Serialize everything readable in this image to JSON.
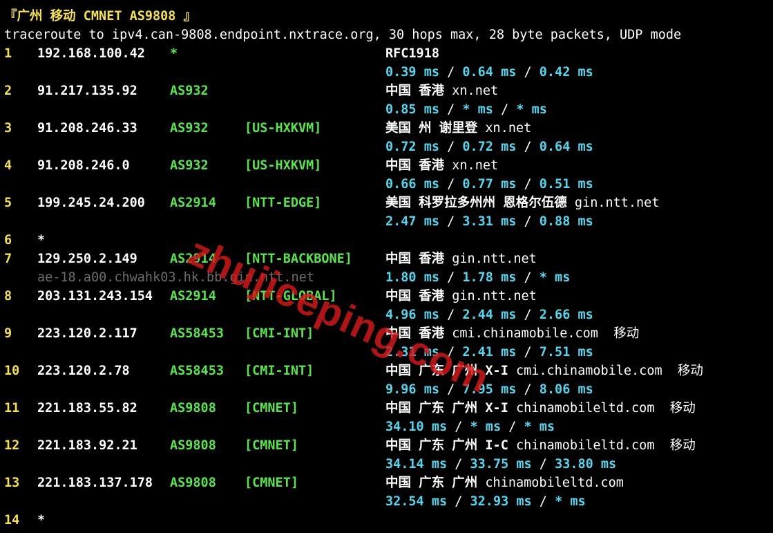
{
  "header": {
    "title": "『广州 移动 CMNET AS9808 』",
    "command": "traceroute to ipv4.can-9808.endpoint.nxtrace.org, 30 hops max, 28 byte packets, UDP mode"
  },
  "hops": [
    {
      "hop": "1",
      "ip": "192.168.100.42",
      "as": "*",
      "tag": "",
      "geo": "RFC1918",
      "org": "",
      "isp": "",
      "rtt": [
        "0.39 ms",
        "0.64 ms",
        "0.42 ms"
      ],
      "rdns": ""
    },
    {
      "hop": "2",
      "ip": "91.217.135.92",
      "as": "AS932",
      "tag": "",
      "geo": "中国 香港 ",
      "org": "xn.net",
      "isp": "",
      "rtt": [
        "0.85 ms",
        "* ms",
        "* ms"
      ],
      "rdns": ""
    },
    {
      "hop": "3",
      "ip": "91.208.246.33",
      "as": "AS932",
      "tag": "[US-HXKVM]",
      "geo": "美国 州 谢里登 ",
      "org": "xn.net",
      "isp": "",
      "rtt": [
        "0.72 ms",
        "0.72 ms",
        "0.64 ms"
      ],
      "rdns": ""
    },
    {
      "hop": "4",
      "ip": "91.208.246.0",
      "as": "AS932",
      "tag": "[US-HXKVM]",
      "geo": "中国 香港 ",
      "org": "xn.net",
      "isp": "",
      "rtt": [
        "0.66 ms",
        "0.77 ms",
        "0.51 ms"
      ],
      "rdns": ""
    },
    {
      "hop": "5",
      "ip": "199.245.24.200",
      "as": "AS2914",
      "tag": "[NTT-EDGE]",
      "geo": "美国 科罗拉多州州 恩格尔伍德 ",
      "org": "gin.ntt.net",
      "isp": "",
      "rtt": [
        "2.47 ms",
        "3.31 ms",
        "0.88 ms"
      ],
      "rdns": ""
    },
    {
      "hop": "6",
      "ip": "*",
      "as": "",
      "tag": "",
      "geo": "",
      "org": "",
      "isp": "",
      "rtt": [],
      "rdns": ""
    },
    {
      "hop": "7",
      "ip": "129.250.2.149",
      "as": "AS2914",
      "tag": "[NTT-BACKBONE]",
      "geo": "中国 香港 ",
      "org": "gin.ntt.net",
      "isp": "",
      "rtt": [
        "1.80 ms",
        "1.78 ms",
        "* ms"
      ],
      "rdns": "ae-18.a00.chwahk03.hk.bb.gin.ntt.net"
    },
    {
      "hop": "8",
      "ip": "203.131.243.154",
      "as": "AS2914",
      "tag": "[NTT-GLOBAL]",
      "geo": "中国 香港 ",
      "org": "gin.ntt.net",
      "isp": "",
      "rtt": [
        "4.96 ms",
        "2.44 ms",
        "2.66 ms"
      ],
      "rdns": ""
    },
    {
      "hop": "9",
      "ip": "223.120.2.117",
      "as": "AS58453",
      "tag": "[CMI-INT]",
      "geo": "中国 香港 ",
      "org": "cmi.chinamobile.com",
      "isp": "移动",
      "rtt": [
        "2.31 ms",
        "2.41 ms",
        "7.51 ms"
      ],
      "rdns": ""
    },
    {
      "hop": "10",
      "ip": "223.120.2.78",
      "as": "AS58453",
      "tag": "[CMI-INT]",
      "geo": "中国 广东 广州 X-I ",
      "org": "cmi.chinamobile.com",
      "isp": "移动",
      "rtt": [
        "9.96 ms",
        "7.95 ms",
        "8.06 ms"
      ],
      "rdns": ""
    },
    {
      "hop": "11",
      "ip": "221.183.55.82",
      "as": "AS9808",
      "tag": "[CMNET]",
      "geo": "中国 广东 广州 X-I ",
      "org": "chinamobileltd.com",
      "isp": "移动",
      "rtt": [
        "34.10 ms",
        "* ms",
        "* ms"
      ],
      "rdns": ""
    },
    {
      "hop": "12",
      "ip": "221.183.92.21",
      "as": "AS9808",
      "tag": "[CMNET]",
      "geo": "中国 广东 广州 I-C ",
      "org": "chinamobileltd.com",
      "isp": "移动",
      "rtt": [
        "34.14 ms",
        "33.75 ms",
        "33.80 ms"
      ],
      "rdns": ""
    },
    {
      "hop": "13",
      "ip": "221.183.137.178",
      "as": "AS9808",
      "tag": "[CMNET]",
      "geo": "中国 广东 广州 ",
      "org": "chinamobileltd.com",
      "isp": "",
      "rtt": [
        "32.54 ms",
        "32.93 ms",
        "* ms"
      ],
      "rdns": ""
    },
    {
      "hop": "14",
      "ip": "*",
      "as": "",
      "tag": "",
      "geo": "",
      "org": "",
      "isp": "",
      "rtt": [],
      "rdns": ""
    }
  ],
  "watermark": "zhujiceping.com",
  "colors": {
    "hop": "#f5e24b",
    "asn": "#57e64a",
    "rtt": "#4fd8ef",
    "rdns": "#6d6d6d",
    "watermark": "#d71919"
  }
}
